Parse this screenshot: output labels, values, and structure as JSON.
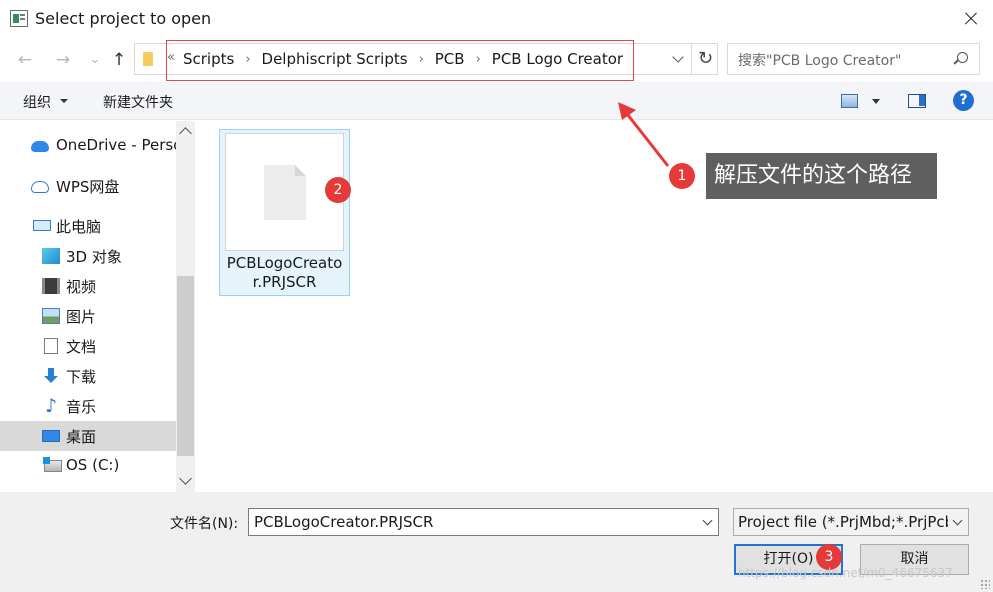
{
  "window": {
    "title": "Select project to open"
  },
  "nav": {
    "back": "←",
    "forward": "→",
    "recent": "⌄",
    "up": "↑",
    "refresh": "↻",
    "crumb_more": "«",
    "breadcrumbs": [
      "Scripts",
      "Delphiscript Scripts",
      "PCB",
      "PCB Logo Creator"
    ],
    "separator": "›",
    "search_placeholder": "搜索\"PCB Logo Creator\""
  },
  "toolbar": {
    "organize": "组织",
    "new_folder": "新建文件夹",
    "help": "?"
  },
  "sidebar": {
    "items": [
      {
        "label": "OneDrive - Personal",
        "icon": "onedrive-icon"
      },
      {
        "label": "WPS网盘",
        "icon": "wps-cloud-icon"
      },
      {
        "label": "此电脑",
        "icon": "this-pc-icon"
      },
      {
        "label": "3D 对象",
        "icon": "3d-objects-icon"
      },
      {
        "label": "视频",
        "icon": "video-icon"
      },
      {
        "label": "图片",
        "icon": "pictures-icon"
      },
      {
        "label": "文档",
        "icon": "documents-icon"
      },
      {
        "label": "下载",
        "icon": "downloads-icon"
      },
      {
        "label": "音乐",
        "icon": "music-icon"
      },
      {
        "label": "桌面",
        "icon": "desktop-icon",
        "selected": true
      },
      {
        "label": "OS (C:)",
        "icon": "drive-icon"
      }
    ]
  },
  "files": [
    {
      "name": "PCBLogoCreator.PRJSCR",
      "selected": true
    }
  ],
  "annotations": {
    "badge1": "1",
    "badge2": "2",
    "badge3": "3",
    "callout": "解压文件的这个路径",
    "color": "#e43a3a"
  },
  "footer": {
    "filename_label": "文件名(N):",
    "filename_value": "PCBLogoCreator.PRJSCR",
    "filetype_value": "Project file (*.PrjMbd;*.PrjPcb",
    "open_button": "打开(O)",
    "cancel_button": "取消",
    "watermark": "https://blog.csdn.net/m0_46675637"
  }
}
